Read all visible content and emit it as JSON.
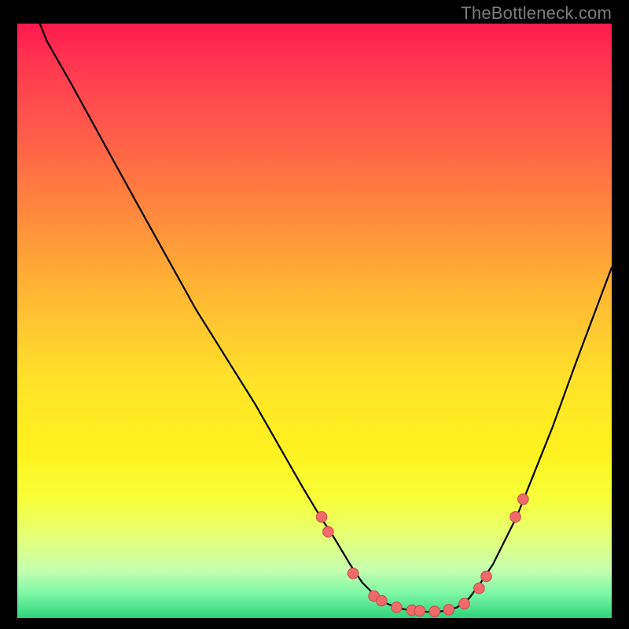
{
  "attribution": "TheBottleneck.com",
  "colors": {
    "point_fill": "#f06a6a",
    "point_stroke": "#c94a4a",
    "curve_stroke": "#000000",
    "background_black": "#000000"
  },
  "chart_data": {
    "type": "line",
    "title": "",
    "xlabel": "",
    "ylabel": "",
    "xlim": [
      0,
      100
    ],
    "ylim": [
      0,
      100
    ],
    "grid": false,
    "left_curve": [
      {
        "x": 3,
        "y": 102
      },
      {
        "x": 5,
        "y": 97
      },
      {
        "x": 9,
        "y": 90
      },
      {
        "x": 20,
        "y": 70
      },
      {
        "x": 30,
        "y": 52
      },
      {
        "x": 40,
        "y": 36
      },
      {
        "x": 48,
        "y": 22
      },
      {
        "x": 51,
        "y": 17
      },
      {
        "x": 53,
        "y": 14
      },
      {
        "x": 56,
        "y": 9
      },
      {
        "x": 58,
        "y": 6
      },
      {
        "x": 60,
        "y": 4
      },
      {
        "x": 62,
        "y": 2.5
      },
      {
        "x": 64,
        "y": 1.7
      },
      {
        "x": 66,
        "y": 1.3
      },
      {
        "x": 68,
        "y": 1.1
      },
      {
        "x": 70,
        "y": 1.0
      }
    ],
    "right_curve": [
      {
        "x": 70,
        "y": 1.0
      },
      {
        "x": 72,
        "y": 1.2
      },
      {
        "x": 74,
        "y": 1.8
      },
      {
        "x": 76,
        "y": 3.3
      },
      {
        "x": 78,
        "y": 6.0
      },
      {
        "x": 80,
        "y": 9.0
      },
      {
        "x": 82,
        "y": 13
      },
      {
        "x": 84,
        "y": 17
      },
      {
        "x": 86,
        "y": 22
      },
      {
        "x": 90,
        "y": 32
      },
      {
        "x": 94,
        "y": 43
      },
      {
        "x": 100,
        "y": 59
      }
    ],
    "points": [
      {
        "x": 51.2,
        "y": 17.0
      },
      {
        "x": 52.3,
        "y": 14.5
      },
      {
        "x": 56.5,
        "y": 7.5
      },
      {
        "x": 60.0,
        "y": 3.7
      },
      {
        "x": 61.3,
        "y": 2.9
      },
      {
        "x": 63.8,
        "y": 1.8
      },
      {
        "x": 66.4,
        "y": 1.3
      },
      {
        "x": 67.7,
        "y": 1.2
      },
      {
        "x": 70.2,
        "y": 1.1
      },
      {
        "x": 72.6,
        "y": 1.4
      },
      {
        "x": 75.2,
        "y": 2.4
      },
      {
        "x": 77.7,
        "y": 5.0
      },
      {
        "x": 78.9,
        "y": 7.0
      },
      {
        "x": 83.8,
        "y": 17.0
      },
      {
        "x": 85.1,
        "y": 20.0
      }
    ],
    "point_radius_pct": 0.9
  }
}
